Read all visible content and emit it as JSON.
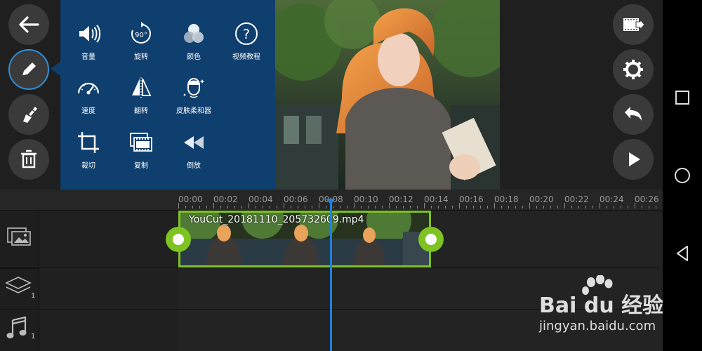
{
  "left_toolbar": {
    "back": "back-arrow-icon",
    "edit": "pencil-icon",
    "effects": "brush-icon",
    "delete": "trash-icon"
  },
  "tools_panel": {
    "items": [
      {
        "icon": "volume-icon",
        "label": "音量"
      },
      {
        "icon": "rotate-90-icon",
        "label": "旋转"
      },
      {
        "icon": "color-circles-icon",
        "label": "颜色"
      },
      {
        "icon": "help-icon",
        "label": "视频教程"
      },
      {
        "icon": "speedometer-icon",
        "label": "速度"
      },
      {
        "icon": "flip-icon",
        "label": "翻转"
      },
      {
        "icon": "face-icon",
        "label": "皮肤柔和器"
      },
      {
        "icon": "crop-icon",
        "label": "裁切"
      },
      {
        "icon": "duplicate-icon",
        "label": "复制"
      },
      {
        "icon": "rewind-icon",
        "label": "倒放"
      }
    ],
    "bg_color": "#0f3f6e"
  },
  "right_toolbar": {
    "export": "export-film-icon",
    "settings": "gear-icon",
    "undo": "undo-icon",
    "play": "play-icon"
  },
  "timeline": {
    "ticks": [
      "00:00",
      "00:02",
      "00:04",
      "00:06",
      "00:08",
      "00:10",
      "00:12",
      "00:14",
      "00:16",
      "00:18",
      "00:20",
      "00:22",
      "00:24",
      "00:26"
    ],
    "clip": {
      "filename": "YouCut_20181110_205732609.mp4",
      "accent": "#7ec322"
    },
    "playhead_color": "#1f82e0",
    "tracks": [
      {
        "icon": "video-track-icon",
        "count": ""
      },
      {
        "icon": "layers-icon",
        "count": "1"
      },
      {
        "icon": "music-note-icon",
        "count": "1"
      }
    ]
  },
  "nav": {
    "square": "recents-icon",
    "circle": "home-icon",
    "triangle": "back-nav-icon"
  },
  "watermark": {
    "brand": "Bai du 经验",
    "url": "jingyan.baidu.com"
  }
}
